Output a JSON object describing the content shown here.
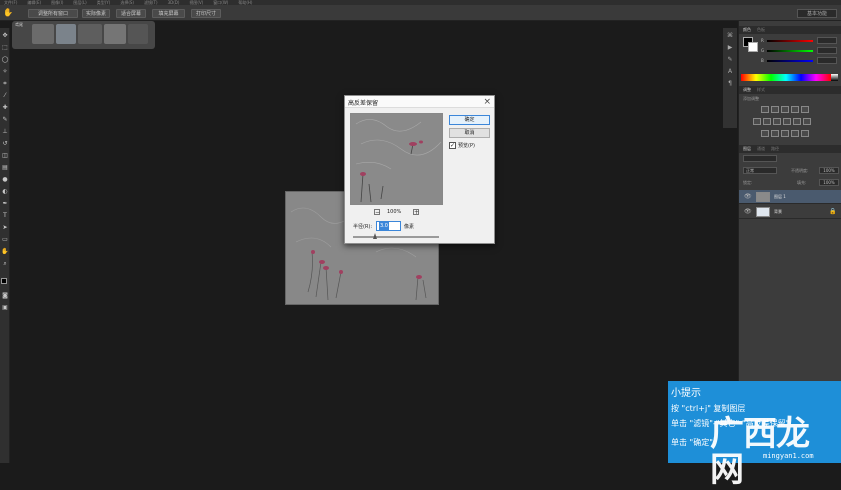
{
  "menubar": {
    "items": [
      "文件(F)",
      "编辑(E)",
      "图像(I)",
      "图层(L)",
      "类型(Y)",
      "选择(S)",
      "滤镜(T)",
      "3D(D)",
      "视图(V)",
      "窗口(W)",
      "帮助(H)"
    ]
  },
  "options": {
    "buttons": [
      "调整所有窗口",
      "实际像素",
      "适合屏幕",
      "填充屏幕",
      "打印尺寸"
    ],
    "workspace": "基本功能"
  },
  "doc_tab": {
    "label": "鸢尾"
  },
  "dialog": {
    "title": "高反差保留",
    "ok": "确定",
    "cancel": "取消",
    "preview_label": "预览(P)",
    "preview_checked": "✓",
    "zoom_out": "−",
    "zoom_in": "+",
    "zoom": "100%",
    "radius_label": "半径(R):",
    "radius_value": "3.0",
    "radius_unit": "像素",
    "close": "×"
  },
  "panels": {
    "color_tabs": [
      "颜色",
      "色板"
    ],
    "channels": [
      "R",
      "G",
      "B"
    ],
    "adjust_tabs": [
      "调整",
      "样式"
    ],
    "adjust_title": "添加调整",
    "layers_tabs": [
      "图层",
      "通道",
      "路径"
    ],
    "blend_mode": "正常",
    "opacity_label": "不透明度:",
    "opacity_value": "100%",
    "lock_label": "锁定:",
    "fill_label": "填充:",
    "fill_value": "100%",
    "layers": [
      {
        "name": "图层 1",
        "selected": true
      },
      {
        "name": "背景",
        "selected": false
      }
    ]
  },
  "tip": {
    "title": "小提示",
    "lines": [
      "按 \"ctrl+j\" 复制图层",
      "单击 \"滤镜\"-\"其它\"-\"高反差保留\"",
      "单击 \"确定\"。"
    ]
  },
  "watermark": {
    "name": "广西龙网",
    "url": "mingyan1.com"
  },
  "colors": {
    "tip_bg": "#1e8fd8",
    "accent": "#3b86d9",
    "panel_bg": "#3c3c3c"
  }
}
